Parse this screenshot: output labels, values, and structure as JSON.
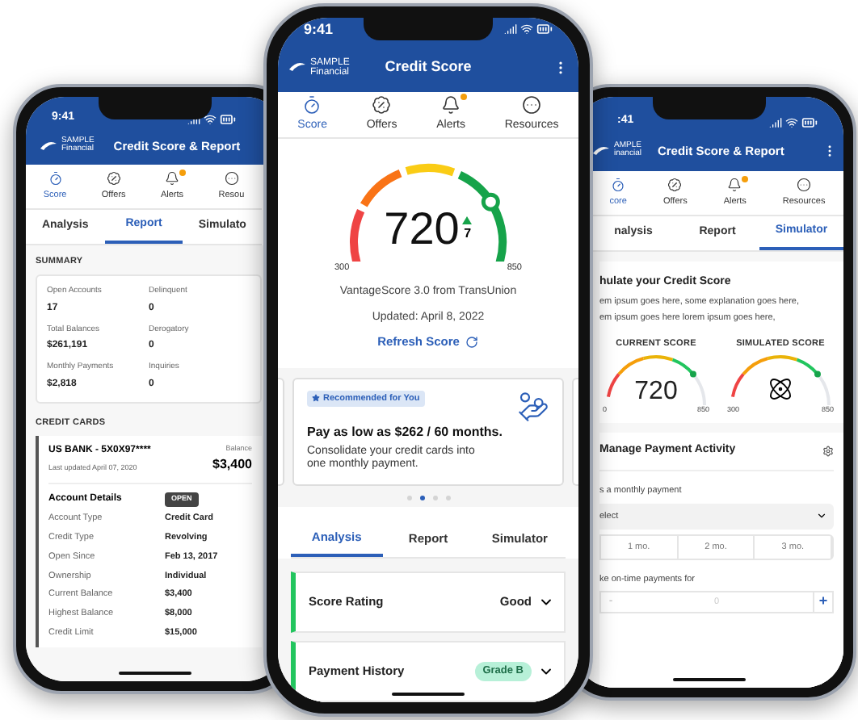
{
  "left_phone": {
    "status_time": "9:41",
    "brand": [
      "SAMPLE",
      "Financial"
    ],
    "title": "Credit Score & Report",
    "nav": [
      {
        "kind": "score",
        "label": "Score",
        "selected": true,
        "alert": false
      },
      {
        "kind": "offers",
        "label": "Offers",
        "selected": false,
        "alert": false
      },
      {
        "kind": "alerts",
        "label": "Alerts",
        "selected": false,
        "alert": true
      },
      {
        "kind": "resources",
        "label": "Resou",
        "selected": false,
        "alert": false
      }
    ],
    "tabs": [
      {
        "label": "Analysis",
        "selected": false
      },
      {
        "label": "Report",
        "selected": true
      },
      {
        "label": "Simulato",
        "selected": false
      }
    ],
    "summary_title": "SUMMARY",
    "summary": [
      {
        "label": "Open Accounts",
        "value": "17"
      },
      {
        "label": "Delinquent",
        "value": "0"
      },
      {
        "label": "Total Balances",
        "value": "$261,191"
      },
      {
        "label": "Derogatory",
        "value": "0"
      },
      {
        "label": "Monthly Payments",
        "value": "$2,818"
      },
      {
        "label": "Inquiries",
        "value": "0"
      }
    ],
    "credit_cards_title": "CREDIT CARDS",
    "account": {
      "name": "US BANK - 5X0X97****",
      "updated": "Last updated April 07, 2020",
      "balance_label": "Balance",
      "balance": "$3,400",
      "details_title": "Account Details",
      "status": "OPEN",
      "details": [
        {
          "label": "Account Type",
          "value": "Credit Card"
        },
        {
          "label": "Credit Type",
          "value": "Revolving"
        },
        {
          "label": "Open Since",
          "value": "Feb 13, 2017"
        },
        {
          "label": "Ownership",
          "value": "Individual"
        },
        {
          "label": "Current Balance",
          "value": "$3,400"
        },
        {
          "label": "Highest Balance",
          "value": "$8,000"
        },
        {
          "label": "Credit Limit",
          "value": "$15,000"
        }
      ]
    }
  },
  "center_phone": {
    "status_time": "9:41",
    "brand": [
      "SAMPLE",
      "Financial"
    ],
    "title": "Credit Score",
    "nav": [
      {
        "kind": "score",
        "label": "Score",
        "selected": true,
        "alert": false
      },
      {
        "kind": "offers",
        "label": "Offers",
        "selected": false,
        "alert": false
      },
      {
        "kind": "alerts",
        "label": "Alerts",
        "selected": false,
        "alert": true
      },
      {
        "kind": "resources",
        "label": "Resources",
        "selected": false,
        "alert": false
      }
    ],
    "score": {
      "value": "720",
      "change": "7",
      "min": "300",
      "max": "850",
      "level": 0.76
    },
    "source": "VantageScore 3.0 from TransUnion",
    "updated": "Updated: April 8, 2022",
    "refresh": "Refresh Score",
    "promo": {
      "badge": "Recommended for You",
      "headline": "Pay as low as $262 / 60 months.",
      "body": "Consolidate your credit cards into one monthly payment."
    },
    "carousel_dots": [
      {
        "selected": false
      },
      {
        "selected": true
      },
      {
        "selected": false
      },
      {
        "selected": false
      }
    ],
    "tabs": [
      {
        "label": "Analysis",
        "selected": true
      },
      {
        "label": "Report",
        "selected": false
      },
      {
        "label": "Simulator",
        "selected": false
      }
    ],
    "sections": [
      {
        "kind": "text",
        "title": "Score Rating",
        "value": "Good"
      },
      {
        "kind": "badge",
        "title": "Payment History",
        "value": "Grade B"
      }
    ]
  },
  "right_phone": {
    "status_time": ":41",
    "brand": [
      "AMPLE",
      "inancial"
    ],
    "title": "Credit Score & Report",
    "nav": [
      {
        "kind": "score",
        "label": "core",
        "selected": true,
        "alert": false
      },
      {
        "kind": "offers",
        "label": "Offers",
        "selected": false,
        "alert": false
      },
      {
        "kind": "alerts",
        "label": "Alerts",
        "selected": false,
        "alert": true
      },
      {
        "kind": "resources",
        "label": "Resources",
        "selected": false,
        "alert": false
      }
    ],
    "tabs": [
      {
        "label": "nalysis",
        "selected": false
      },
      {
        "label": "Report",
        "selected": false
      },
      {
        "label": "Simulator",
        "selected": true
      }
    ],
    "sim_title": "hulate your Credit Score",
    "sim_text": [
      "em ipsum goes here, some explanation goes here,",
      "em ipsum goes here lorem ipsum goes here,"
    ],
    "scores": [
      {
        "kind": "number",
        "label": "CURRENT SCORE",
        "value": "720",
        "min": "0",
        "max": "850"
      },
      {
        "kind": "atom",
        "label": "SIMULATED SCORE",
        "min": "300",
        "max": "850"
      }
    ],
    "manage_title": "Manage Payment Activity",
    "monthly_label": "s a monthly payment",
    "select": "elect",
    "months": [
      "1 mo.",
      "2 mo.",
      "3 mo."
    ],
    "ontime_label": "ke on-time payments for",
    "stepper": {
      "minus": "-",
      "value": "0",
      "plus": "+"
    }
  }
}
